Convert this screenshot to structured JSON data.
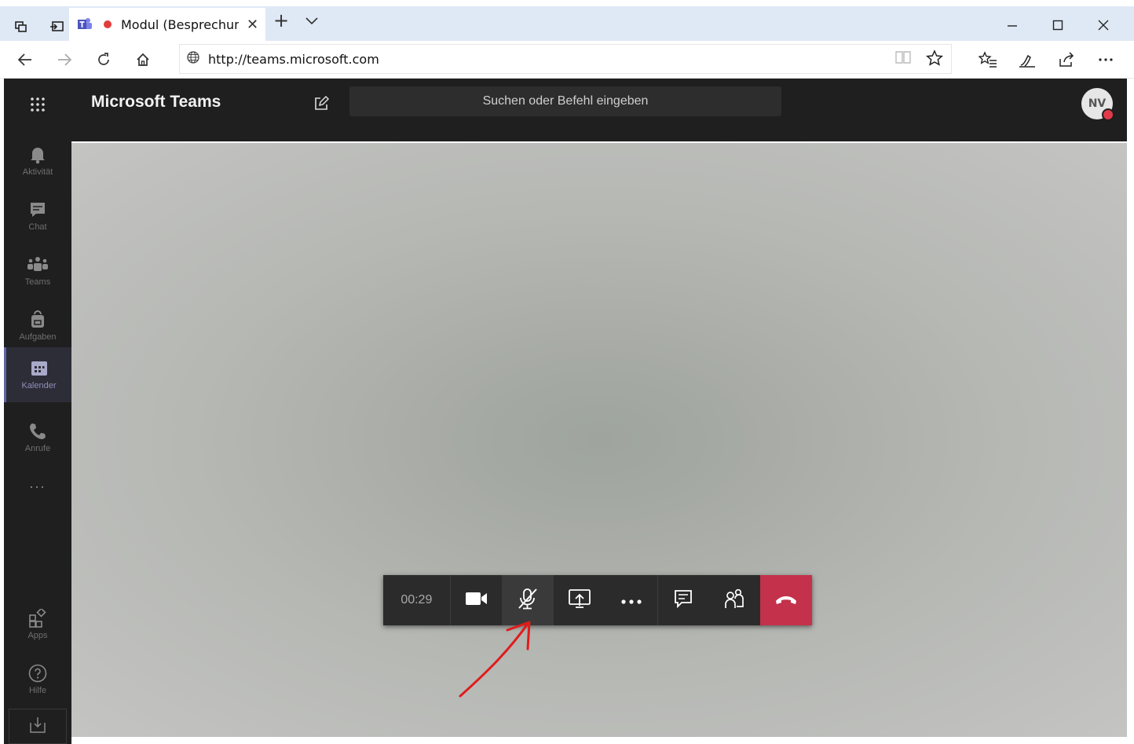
{
  "browser": {
    "tab_title": "Modul (Besprechun",
    "url": "http://teams.microsoft.com",
    "icons": [
      "tab-preview-icon",
      "set-aside-icon",
      "teams-favicon",
      "recording-dot",
      "close-icon",
      "new-tab-icon",
      "chevron-down-icon",
      "minimize-icon",
      "maximize-icon",
      "close-window-icon",
      "back-icon",
      "forward-icon",
      "refresh-icon",
      "home-icon",
      "globe-icon",
      "reading-view-icon",
      "favorite-star-icon",
      "favorites-list-icon",
      "pen-icon",
      "share-icon",
      "more-icon"
    ]
  },
  "teams": {
    "title": "Microsoft Teams",
    "search_placeholder": "Suchen oder Befehl eingeben",
    "avatar_initials": "NV",
    "rail": [
      {
        "label": "Aktivität"
      },
      {
        "label": "Chat"
      },
      {
        "label": "Teams"
      },
      {
        "label": "Aufgaben"
      },
      {
        "label": "Kalender"
      },
      {
        "label": "Anrufe"
      },
      {
        "label": "..."
      },
      {
        "label": "Apps"
      },
      {
        "label": "Hilfe"
      }
    ],
    "active_rail_item": "Kalender",
    "call": {
      "timer": "00:29",
      "controls": [
        "camera",
        "mic-muted",
        "share-screen",
        "more",
        "chat",
        "participants",
        "hang-up"
      ]
    }
  },
  "colors": {
    "teams_dark": "#1f1f1f",
    "hangup_red": "#c4314b",
    "accent_purple": "#6264a7",
    "annotation_red": "#e01b1b"
  }
}
